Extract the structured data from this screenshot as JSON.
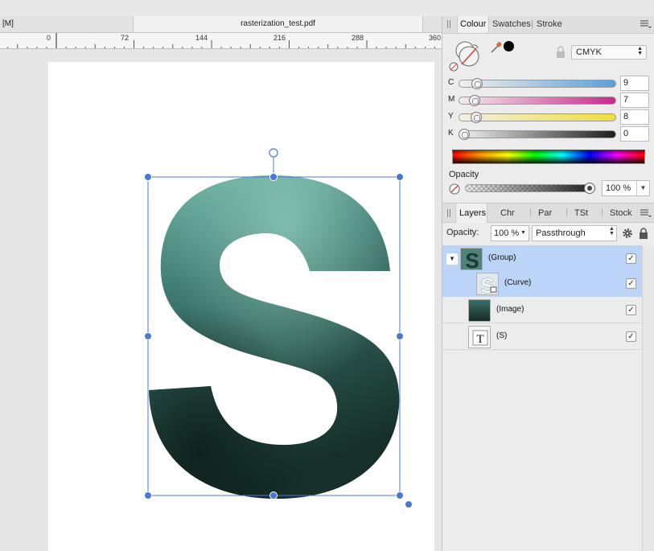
{
  "document": {
    "left_tab": "[M]",
    "active_tab": "rasterization_test.pdf"
  },
  "ruler": {
    "ticks": [
      "0",
      "72",
      "144",
      "216",
      "288",
      "360"
    ]
  },
  "colour_panel": {
    "tabs": [
      "Colour",
      "Swatches",
      "Stroke"
    ],
    "active_tab": "Colour",
    "model": "CMYK",
    "channels": [
      {
        "label": "C",
        "value": "9",
        "fraction": 0.09
      },
      {
        "label": "M",
        "value": "7",
        "fraction": 0.07
      },
      {
        "label": "Y",
        "value": "8",
        "fraction": 0.08
      },
      {
        "label": "K",
        "value": "0",
        "fraction": 0.0
      }
    ],
    "opacity_label": "Opacity",
    "opacity_value": "100 %",
    "opacity_fraction": 1.0
  },
  "layers_panel": {
    "tabs": [
      "Layers",
      "Chr",
      "Par",
      "TSt",
      "Stock"
    ],
    "active_tab": "Layers",
    "opacity_label": "Opacity:",
    "opacity_value": "100 %",
    "blend_mode": "Passthrough",
    "items": [
      {
        "name": "(Group)",
        "selected": true,
        "visible": true
      },
      {
        "name": "(Curve)",
        "selected": true,
        "visible": true
      },
      {
        "name": "(Image)",
        "selected": false,
        "visible": true
      },
      {
        "name": "(S)",
        "selected": false,
        "visible": true
      }
    ]
  },
  "colors": {
    "selection_blue": "#4a78d6",
    "layer_selected_bg": "#bcd4f7",
    "artwork_teal_light": "#5fa596",
    "artwork_teal_dark": "#1a3431"
  }
}
